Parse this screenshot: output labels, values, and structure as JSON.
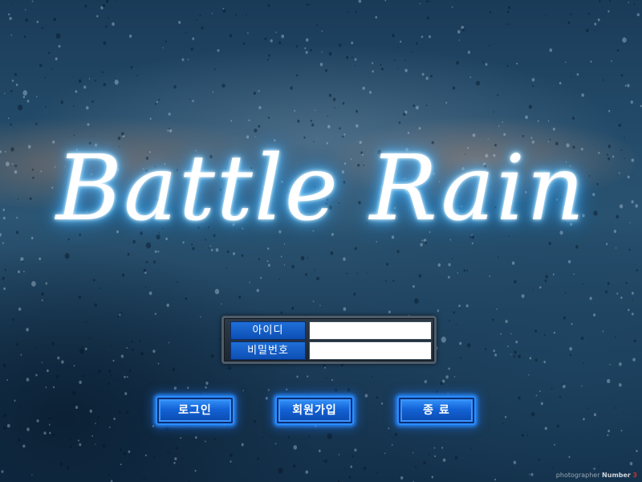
{
  "app": {
    "logo_text": "Battle Rain"
  },
  "login": {
    "id_label": "아이디",
    "id_value": "",
    "password_label": "비밀번호",
    "password_value": ""
  },
  "buttons": {
    "login_label": "로그인",
    "signup_label": "회원가입",
    "exit_label": "종  료"
  },
  "credit": {
    "prefix": "photographer",
    "name": "Number",
    "mark": "3"
  },
  "colors": {
    "button_blue": "#1363d6",
    "label_blue": "#0d4fb5",
    "glow": "#3fb2ff"
  }
}
